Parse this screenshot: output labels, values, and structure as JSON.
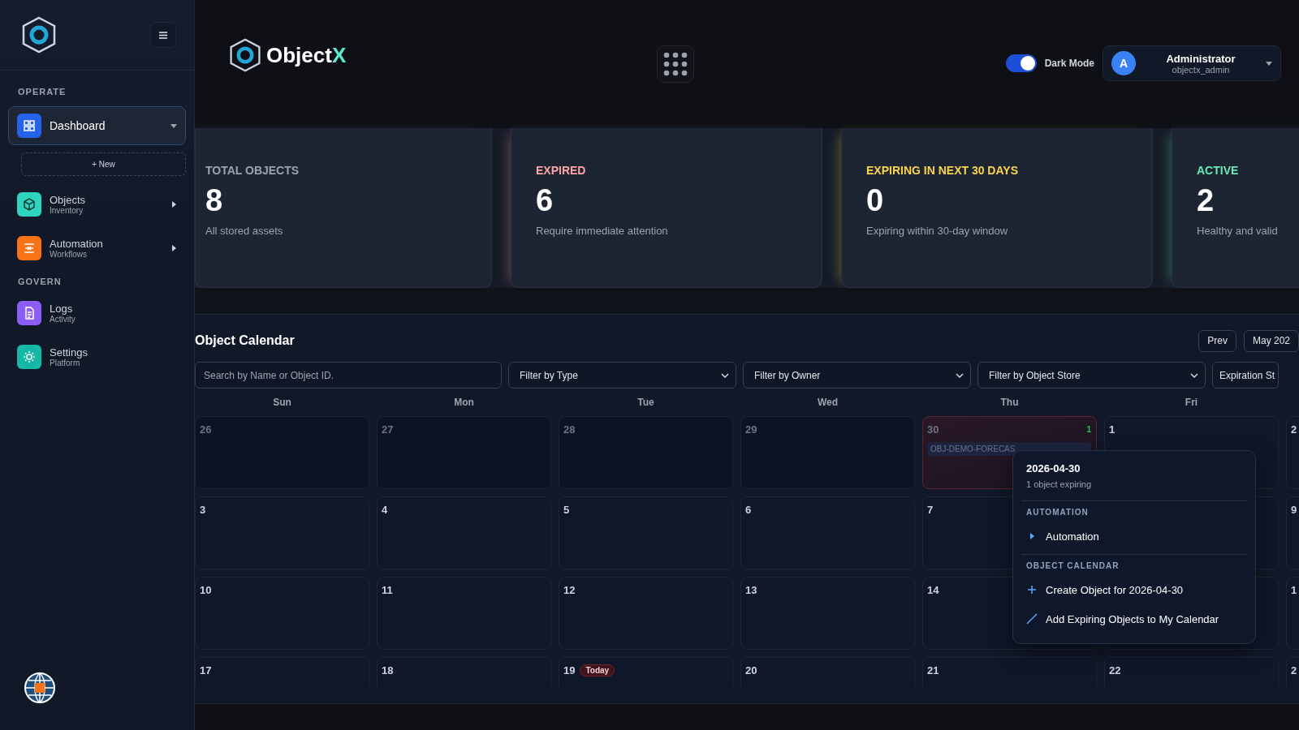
{
  "sidebar": {
    "menu_button": {
      "kind": "menu"
    },
    "sections": [
      {
        "title": "OPERATE",
        "items": [
          {
            "label": "Dashboard",
            "selected": true,
            "expanded": true,
            "new_button": "+ New"
          },
          {
            "label": "Objects",
            "sublabel": "Inventory",
            "selected": false,
            "expanded": false
          },
          {
            "label": "Automation",
            "sublabel": "Workflows",
            "selected": false,
            "expanded": false
          }
        ]
      },
      {
        "title": "GOVERN",
        "items": [
          {
            "label": "Logs",
            "sublabel": "Activity",
            "selected": false
          },
          {
            "label": "Settings",
            "sublabel": "Platform",
            "selected": false
          }
        ]
      }
    ]
  },
  "header": {
    "brand": {
      "name": "Object",
      "accent": "X"
    },
    "dark_mode": {
      "label": "Dark Mode",
      "on": true
    },
    "user": {
      "avatar": "A",
      "name": "Administrator",
      "username": "objectx_admin"
    }
  },
  "stats": [
    {
      "label": "TOTAL OBJECTS",
      "value": "8",
      "caption": "All stored assets",
      "color": "#9ca3af"
    },
    {
      "label": "EXPIRED",
      "value": "6",
      "caption": "Require immediate attention",
      "color": "#fca5a5"
    },
    {
      "label": "EXPIRING IN NEXT 30 DAYS",
      "value": "0",
      "caption": "Expiring within 30-day window",
      "color": "#fcd34d"
    },
    {
      "label": "ACTIVE",
      "value": "2",
      "caption": "Healthy and valid",
      "color": "#6ee7b7"
    }
  ],
  "calendar": {
    "title": "Object Calendar",
    "buttons": [
      "Prev",
      "May 202"
    ],
    "search": {
      "placeholder": "Search by Name or Object ID."
    },
    "filters": [
      {
        "label": "Filter by Type",
        "kind": "select"
      },
      {
        "label": "Filter by Owner",
        "kind": "select"
      },
      {
        "label": "Filter by Object Store",
        "kind": "select"
      },
      {
        "label": "Expiration St",
        "kind": "cut"
      }
    ],
    "weekdays": [
      "Sun",
      "Mon",
      "Tue",
      "Wed",
      "Thu",
      "Fri"
    ],
    "weeks": [
      [
        {
          "kind": "day",
          "day": "26",
          "outside": true
        },
        {
          "kind": "day",
          "day": "27",
          "outside": true
        },
        {
          "kind": "day",
          "day": "28",
          "outside": true
        },
        {
          "kind": "day",
          "day": "29",
          "outside": true
        },
        {
          "kind": "day",
          "day": "30",
          "outside": true,
          "expired": true,
          "count": "1",
          "events": [
            "OBJ-DEMO-FORECAS"
          ]
        },
        {
          "kind": "day",
          "day": "1",
          "outside": false
        },
        {
          "kind": "day",
          "day": "2",
          "outside": false
        }
      ],
      [
        {
          "kind": "day",
          "day": "3",
          "outside": false
        },
        {
          "kind": "day",
          "day": "4",
          "outside": false
        },
        {
          "kind": "day",
          "day": "5",
          "outside": false
        },
        {
          "kind": "day",
          "day": "6",
          "outside": false
        },
        {
          "kind": "day",
          "day": "7",
          "outside": false
        },
        {
          "kind": "covered"
        },
        {
          "kind": "day",
          "day": "9",
          "outside": false
        }
      ],
      [
        {
          "kind": "day",
          "day": "10",
          "outside": false
        },
        {
          "kind": "day",
          "day": "11",
          "outside": false
        },
        {
          "kind": "day",
          "day": "12",
          "outside": false
        },
        {
          "kind": "day",
          "day": "13",
          "outside": false
        },
        {
          "kind": "day",
          "day": "14",
          "outside": false
        },
        {
          "kind": "covered"
        },
        {
          "kind": "day",
          "day": "1",
          "outside": false
        }
      ],
      [
        {
          "kind": "day",
          "day": "17",
          "outside": false
        },
        {
          "kind": "day",
          "day": "18",
          "outside": false
        },
        {
          "kind": "day",
          "day": "19",
          "outside": false,
          "badge": "Today"
        },
        {
          "kind": "day",
          "day": "20",
          "outside": false
        },
        {
          "kind": "day",
          "day": "21",
          "outside": false
        },
        {
          "kind": "day",
          "day": "22",
          "outside": false
        },
        {
          "kind": "day",
          "day": "2",
          "outside": false
        }
      ]
    ]
  },
  "popover": {
    "title": "2026-04-30",
    "subtitle": "1 object expiring",
    "sections": [
      {
        "title": "AUTOMATION",
        "items": [
          {
            "label": "Automation"
          }
        ]
      },
      {
        "title": "OBJECT CALENDAR",
        "items": [
          {
            "label": "Create Object for 2026-04-30"
          },
          {
            "label": "Add Expiring Objects to My Calendar"
          }
        ]
      }
    ]
  }
}
